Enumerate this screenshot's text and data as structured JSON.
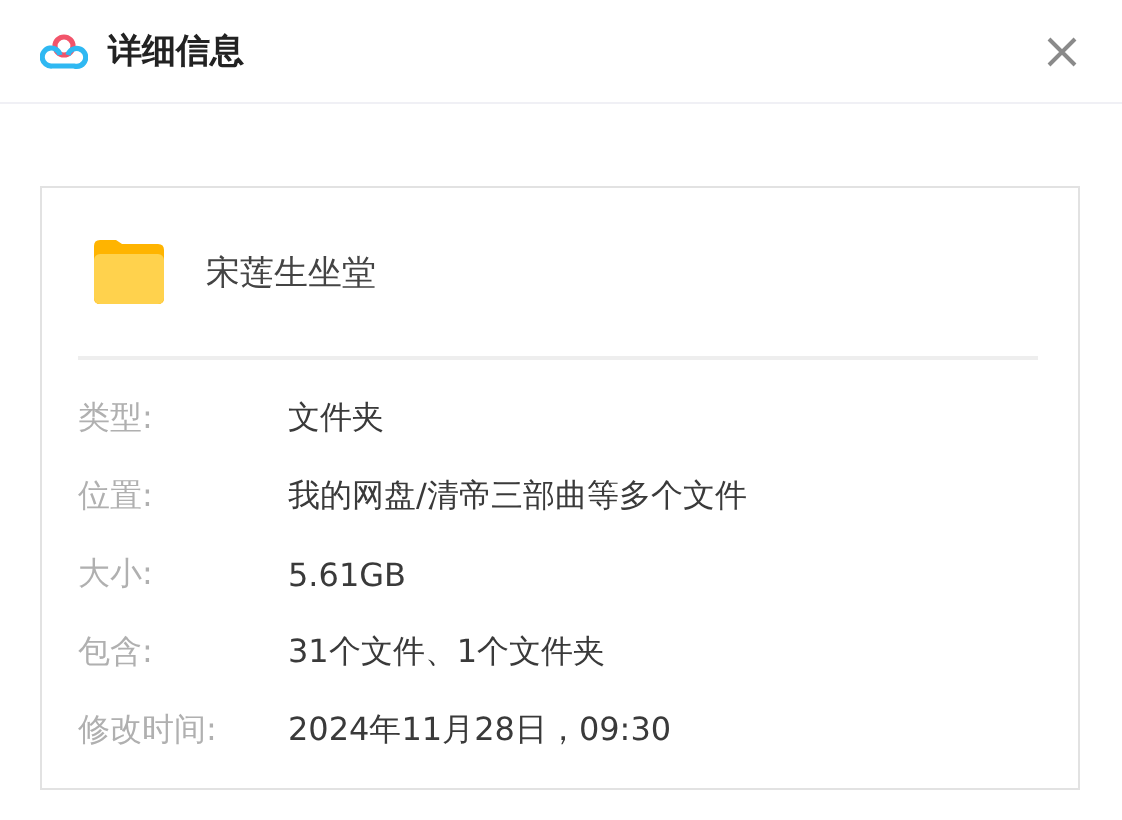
{
  "window": {
    "title": "详细信息"
  },
  "item": {
    "name": "宋莲生坐堂"
  },
  "details": [
    {
      "label": "类型:",
      "value": "文件夹"
    },
    {
      "label": "位置:",
      "value": "我的网盘/清帝三部曲等多个文件"
    },
    {
      "label": "大小:",
      "value": "5.61GB"
    },
    {
      "label": "包含:",
      "value": "31个文件、1个文件夹"
    },
    {
      "label": "修改时间:",
      "value": "2024年11月28日，09:30"
    }
  ]
}
